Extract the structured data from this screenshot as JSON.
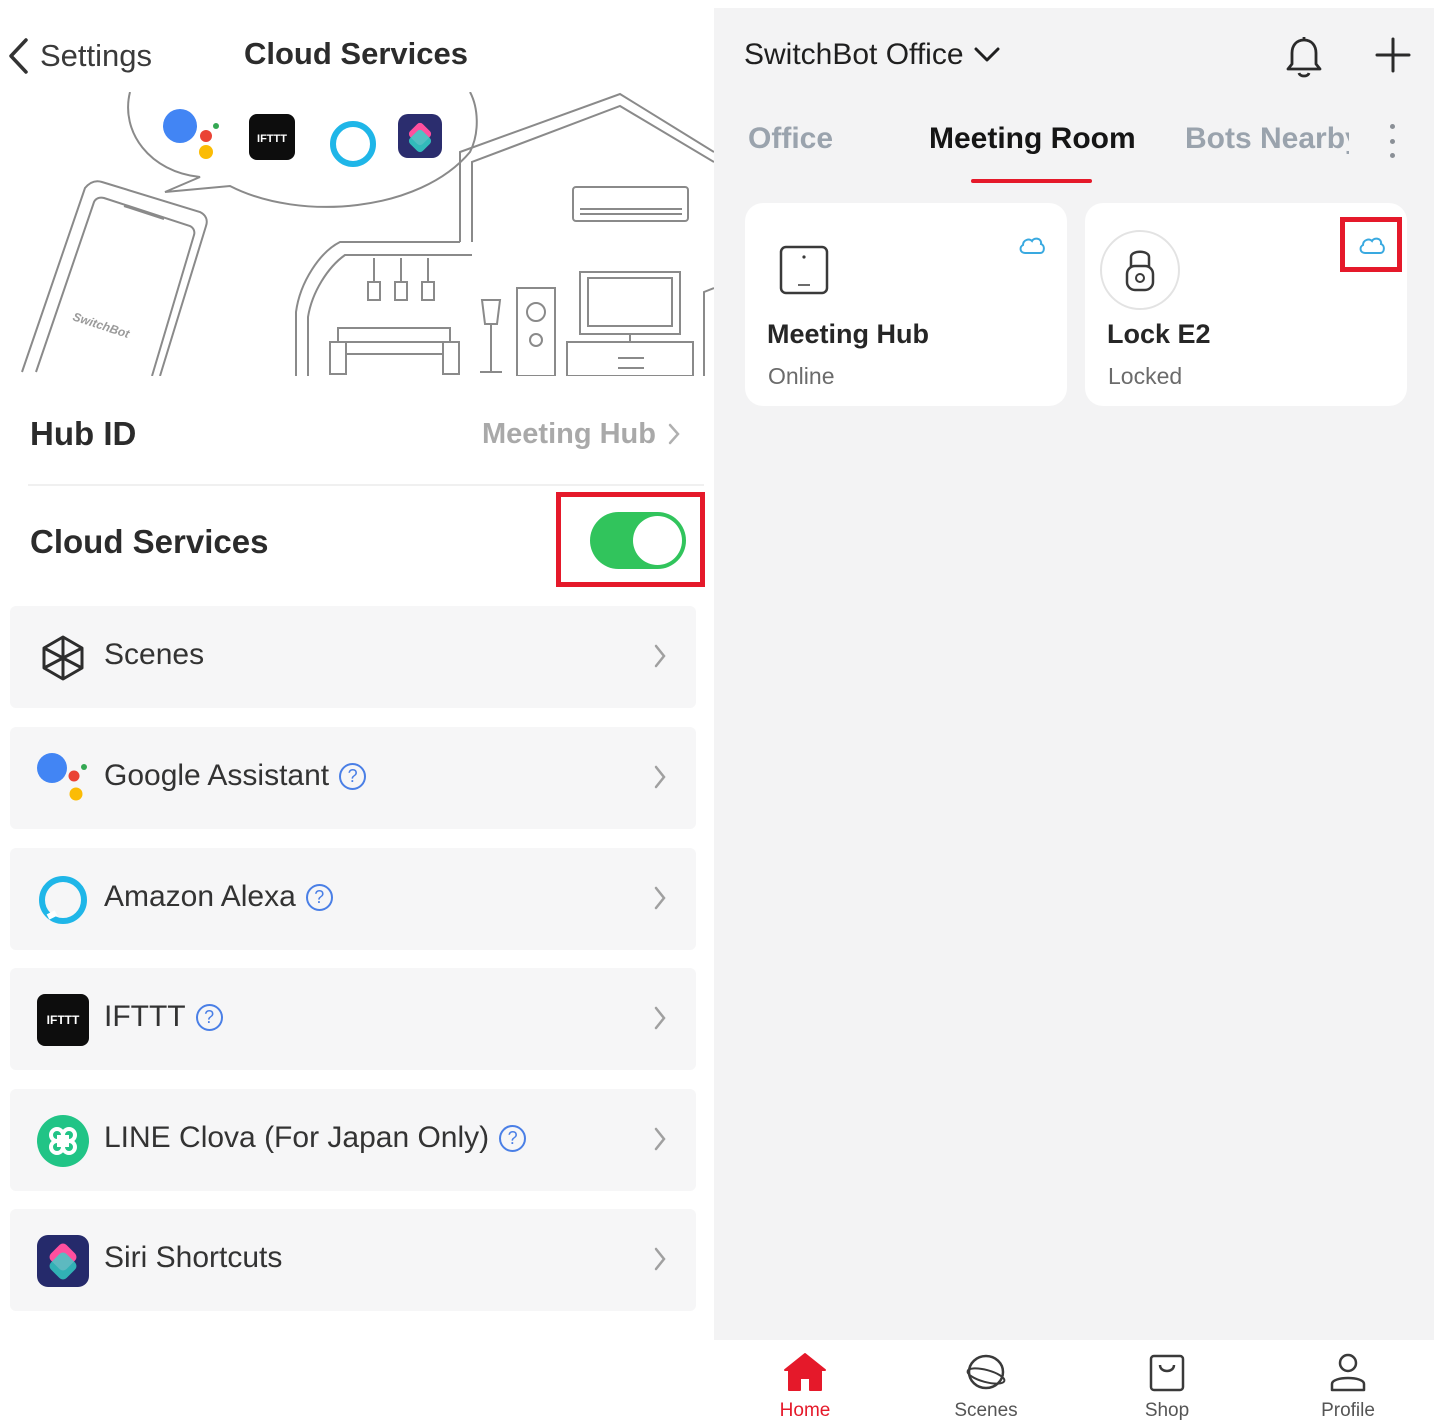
{
  "left_screen": {
    "back_label": "Settings",
    "title": "Cloud Services",
    "hero": {
      "phone_brand": "SwitchBot",
      "ifttt_badge": "IFTTT"
    },
    "hub_row": {
      "label": "Hub ID",
      "value": "Meeting Hub"
    },
    "cloud_row": {
      "label": "Cloud Services",
      "toggle_on": true
    },
    "services": [
      {
        "label": "Scenes",
        "icon": "scenes-cube-icon",
        "has_help": false
      },
      {
        "label": "Google Assistant",
        "icon": "google-assistant-icon",
        "has_help": true
      },
      {
        "label": "Amazon Alexa",
        "icon": "alexa-icon",
        "has_help": true
      },
      {
        "label": "IFTTT",
        "icon": "ifttt-icon",
        "badge_text": "IFTTT",
        "has_help": true
      },
      {
        "label": "LINE Clova (For Japan Only)",
        "icon": "line-clova-icon",
        "has_help": true
      },
      {
        "label": "Siri Shortcuts",
        "icon": "siri-shortcuts-icon",
        "has_help": false
      }
    ]
  },
  "right_screen": {
    "home_title": "SwitchBot Office",
    "tabs": [
      {
        "label": "Office",
        "active": false
      },
      {
        "label": "Meeting Room",
        "active": true
      },
      {
        "label": "Bots Nearby",
        "active": false
      }
    ],
    "devices": [
      {
        "name": "Meeting Hub",
        "status": "Online",
        "icon": "hub-device-icon",
        "cloud": true
      },
      {
        "name": "Lock E2",
        "status": "Locked",
        "icon": "lock-device-icon",
        "cloud": true
      }
    ]
  },
  "bottom_nav": [
    {
      "label": "Home",
      "icon": "home-icon",
      "active": true
    },
    {
      "label": "Scenes",
      "icon": "scenes-icon",
      "active": false
    },
    {
      "label": "Shop",
      "icon": "shop-bag-icon",
      "active": false
    },
    {
      "label": "Profile",
      "icon": "profile-icon",
      "active": false
    }
  ],
  "colors": {
    "accent_red": "#e5192a",
    "toggle_green": "#31c45c",
    "help_blue": "#4a7fe6",
    "cloud_blue": "#39a9e0",
    "inactive_tab": "#9aa3ad"
  }
}
